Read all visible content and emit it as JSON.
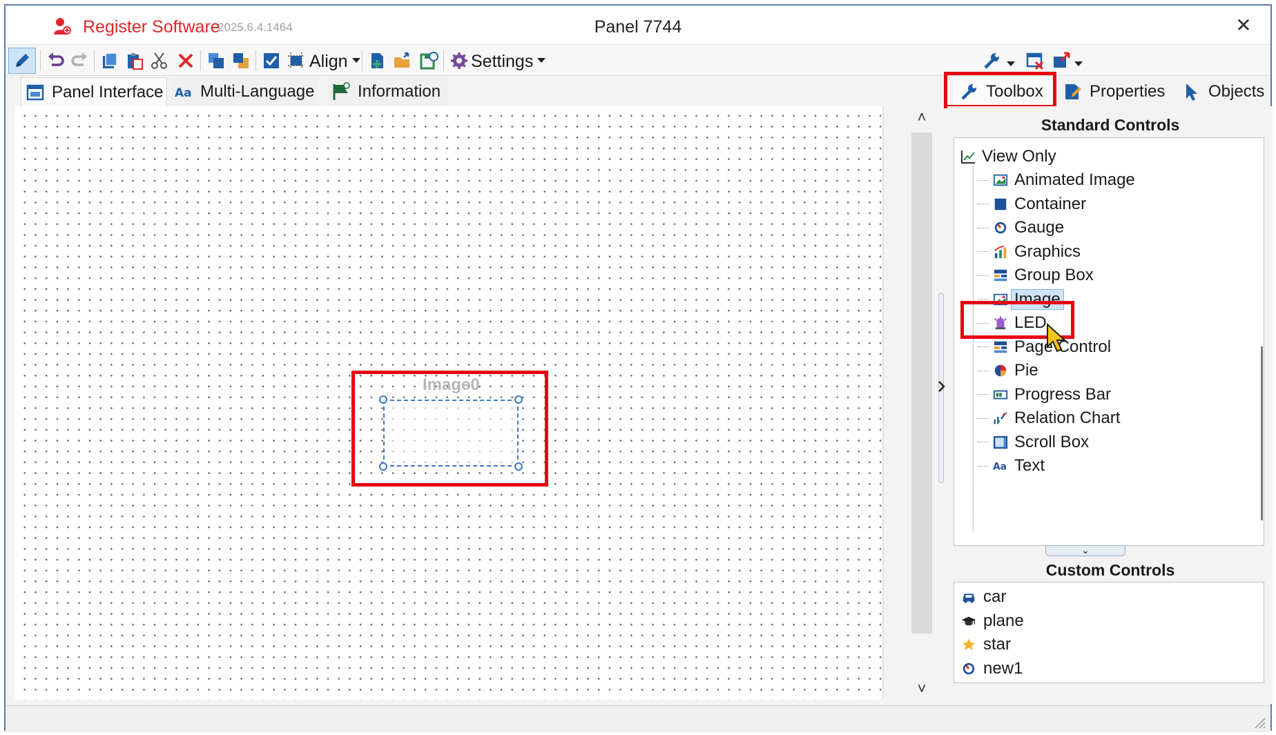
{
  "titlebar": {
    "register_label": "Register Software",
    "version": "2025.6.4.1464",
    "window_title": "Panel 7744",
    "close_glyph": "✕"
  },
  "toolbar": {
    "align_label": "Align",
    "settings_label": "Settings",
    "icons": [
      "pencil-icon",
      "undo-icon",
      "redo-icon",
      "copy-icon",
      "paste-icon",
      "cut-icon",
      "delete-icon",
      "bring-front-icon",
      "send-back-icon",
      "checkbox-icon",
      "align-icon",
      "add-page-icon",
      "open-folder-icon",
      "save-screen-icon",
      "gear-icon",
      "wrench-icon",
      "window-close-icon",
      "window-export-icon"
    ]
  },
  "left_tabs": {
    "panel_interface": "Panel Interface",
    "multi_language": "Multi-Language",
    "information": "Information"
  },
  "canvas": {
    "control_caption": "Image0",
    "scroll_up": "˄",
    "scroll_down": "˅"
  },
  "right_tabs": {
    "toolbox": "Toolbox",
    "properties": "Properties",
    "objects": "Objects"
  },
  "toolbox": {
    "standard_header": "Standard Controls",
    "root_label": "View Only",
    "items": [
      {
        "label": "Animated Image",
        "icon": "animated-image-icon"
      },
      {
        "label": "Container",
        "icon": "container-icon"
      },
      {
        "label": "Gauge",
        "icon": "gauge-icon"
      },
      {
        "label": "Graphics",
        "icon": "graphics-icon"
      },
      {
        "label": "Group Box",
        "icon": "group-box-icon"
      },
      {
        "label": "Image",
        "icon": "image-icon",
        "selected": true
      },
      {
        "label": "LED",
        "icon": "led-icon"
      },
      {
        "label": "Page Control",
        "icon": "page-control-icon"
      },
      {
        "label": "Pie",
        "icon": "pie-icon"
      },
      {
        "label": "Progress Bar",
        "icon": "progress-bar-icon"
      },
      {
        "label": "Relation Chart",
        "icon": "relation-chart-icon"
      },
      {
        "label": "Scroll Box",
        "icon": "scroll-box-icon"
      },
      {
        "label": "Text",
        "icon": "text-icon"
      }
    ],
    "custom_header": "Custom Controls",
    "custom_items": [
      {
        "label": "car",
        "icon": "car-icon"
      },
      {
        "label": "plane",
        "icon": "plane-icon"
      },
      {
        "label": "star",
        "icon": "star-icon"
      },
      {
        "label": "new1",
        "icon": "gauge-icon"
      }
    ]
  },
  "colors": {
    "accent_red": "#e0262b",
    "annotation_red": "#e60012",
    "selection_blue": "#3d78c8"
  }
}
